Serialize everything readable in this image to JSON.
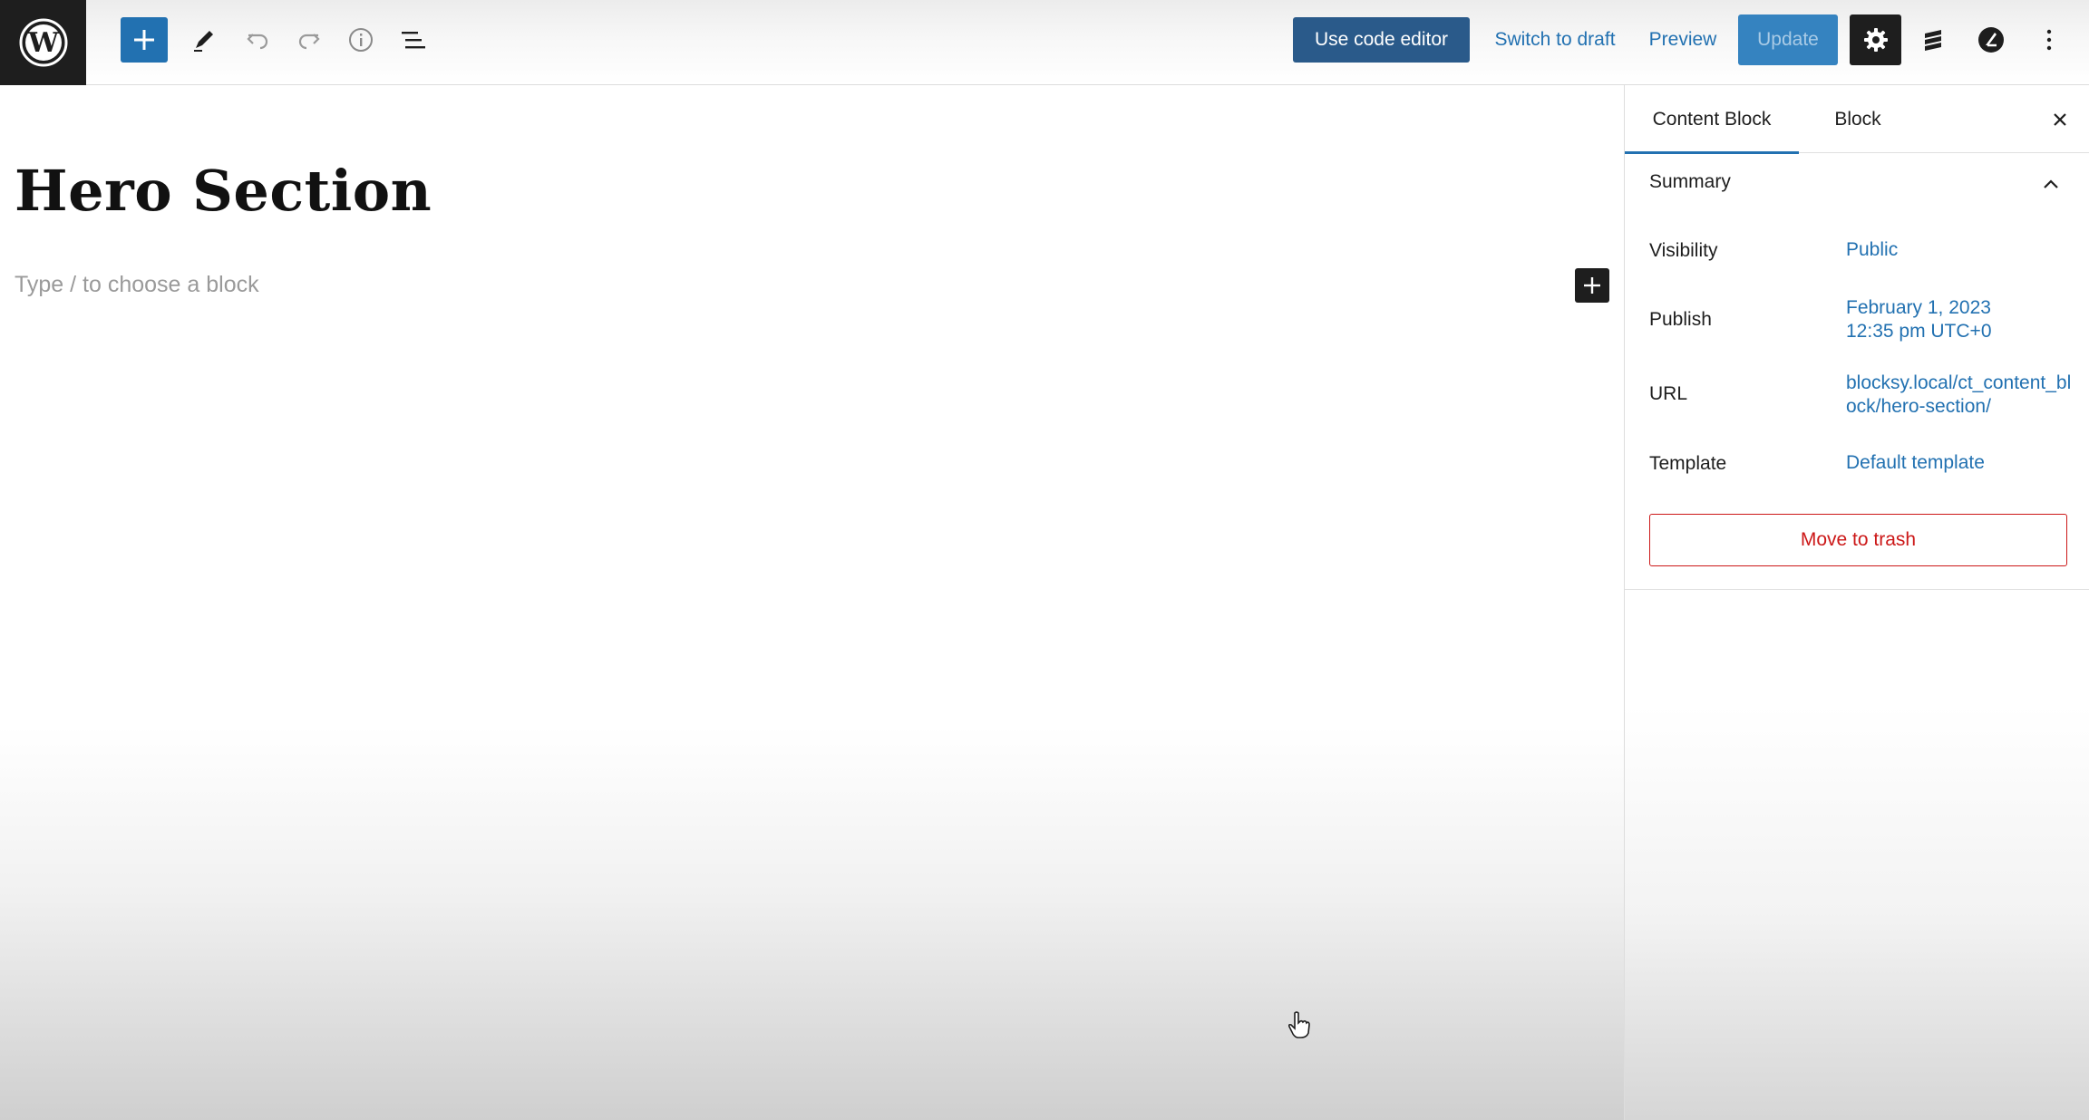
{
  "toolbar": {
    "use_code_editor": "Use code editor",
    "switch_to_draft": "Switch to draft",
    "preview": "Preview",
    "update": "Update",
    "icons": [
      "wordpress-logo-icon",
      "plus-icon",
      "pencil-icon",
      "undo-icon",
      "redo-icon",
      "info-icon",
      "list-view-icon",
      "gear-icon",
      "blocksy-icon",
      "plugin-icon",
      "more-vertical-icon"
    ]
  },
  "editor": {
    "title": "Hero Section",
    "block_placeholder": "Type / to choose a block"
  },
  "sidebar": {
    "tabs": [
      "Content Block",
      "Block"
    ],
    "summary": {
      "title": "Summary",
      "rows": [
        {
          "label": "Visibility",
          "value": "Public"
        },
        {
          "label": "Publish",
          "value_line1": "February 1, 2023",
          "value_line2": "12:35 pm UTC+0"
        },
        {
          "label": "URL",
          "value": "blocksy.local/ct_content_block/hero-section/"
        },
        {
          "label": "Template",
          "value": "Default template"
        }
      ],
      "trash_label": "Move to trash"
    }
  },
  "colors": {
    "accent": "#2271b1",
    "code_editor_bg": "#2a5a8a",
    "update_bg": "#3583c0",
    "danger": "#cc1818",
    "dark": "#1e1e1e"
  }
}
